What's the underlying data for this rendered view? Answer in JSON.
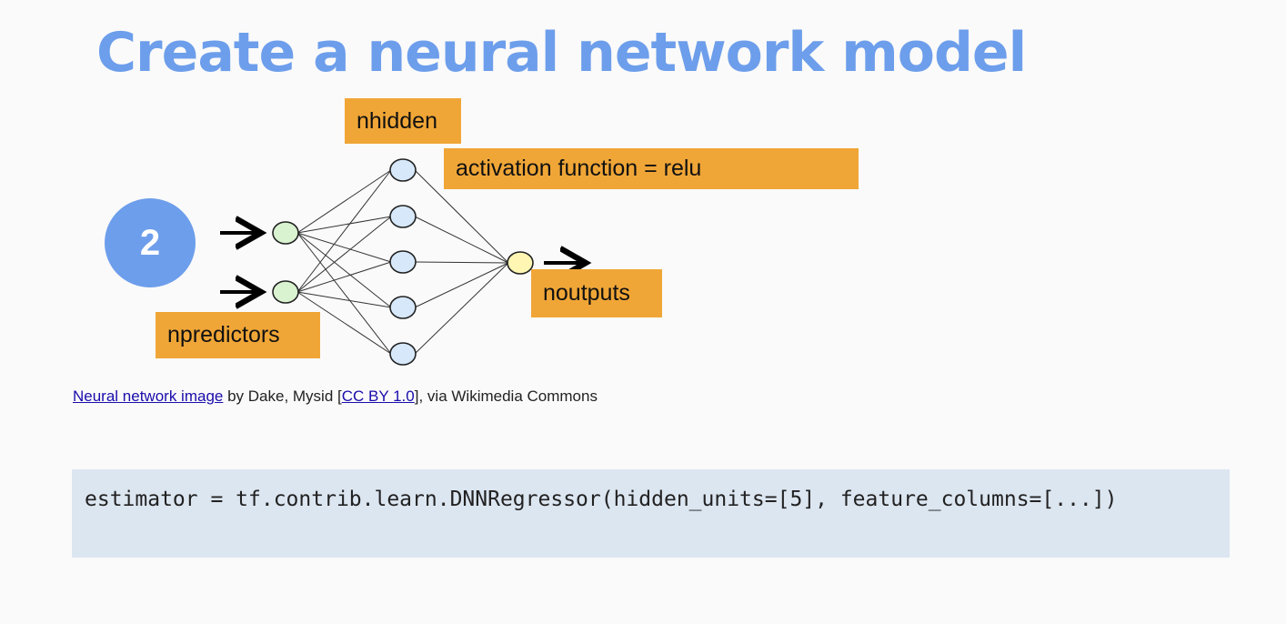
{
  "slide": {
    "title": "Create a neural network model"
  },
  "diagram": {
    "badge_number": "2",
    "labels": {
      "nhidden": "nhidden",
      "activation": "activation function = relu",
      "npredictors": "npredictors",
      "noutputs": "noutputs"
    },
    "layers": {
      "input": 2,
      "hidden": 5,
      "output": 1
    },
    "colors": {
      "input_node": "#d9f2d0",
      "hidden_node": "#d6e8fa",
      "output_node": "#fff6b3",
      "label_bg": "#f0a637",
      "badge": "#6d9eeb"
    }
  },
  "caption": {
    "image_link": "Neural network image",
    "by_text": " by Dake, Mysid [",
    "license_link": "CC BY 1.0",
    "source_text": "], via Wikimedia Commons"
  },
  "code": {
    "text": "estimator = tf.contrib.learn.DNNRegressor(hidden_units=[5], feature_columns=[...])"
  }
}
